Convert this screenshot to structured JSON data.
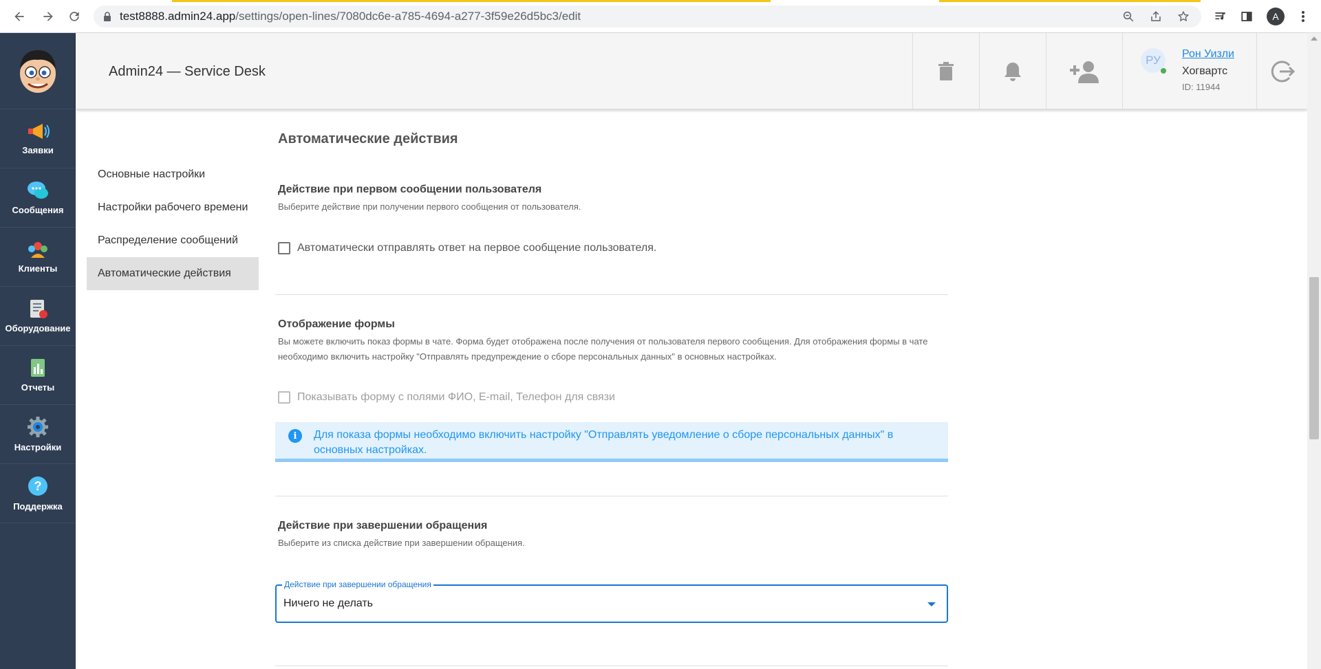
{
  "browser": {
    "url_host": "test8888.admin24.app",
    "url_path": "/settings/open-lines/7080dc6e-a785-4694-a277-3f59e26d5bc3/edit",
    "profile_initial": "A"
  },
  "sidebar": {
    "items": [
      {
        "label": "Заявки",
        "icon": "megaphone-icon"
      },
      {
        "label": "Сообщения",
        "icon": "chat-bubbles-icon"
      },
      {
        "label": "Клиенты",
        "icon": "clients-icon"
      },
      {
        "label": "Оборудование",
        "icon": "equipment-icon"
      },
      {
        "label": "Отчеты",
        "icon": "reports-icon"
      },
      {
        "label": "Настройки",
        "icon": "gear-icon"
      },
      {
        "label": "Поддержка",
        "icon": "help-icon"
      }
    ]
  },
  "header": {
    "title": "Admin24 — Service Desk",
    "user": {
      "initials": "РУ",
      "name": "Рон Уизли",
      "org": "Хогвартс",
      "id": "ID: 11944"
    }
  },
  "subnav": {
    "items": [
      {
        "label": "Основные настройки"
      },
      {
        "label": "Настройки рабочего времени"
      },
      {
        "label": "Распределение сообщений"
      },
      {
        "label": "Автоматические действия"
      }
    ]
  },
  "main": {
    "title": "Автоматические действия",
    "first_message": {
      "title": "Действие при первом сообщении пользователя",
      "description": "Выберите действие при получении первого сообщения от пользователя.",
      "checkbox_label": "Автоматически отправлять ответ на первое сообщение пользователя."
    },
    "form_display": {
      "title": "Отображение формы",
      "description": "Вы можете включить показ формы в чате. Форма будет отображена после получения от пользователя первого сообщения. Для отображения формы в чате необходимо включить настройку \"Отправлять предупреждение о сборе персональных данных\" в основных настройках.",
      "checkbox_label": "Показывать форму с полями ФИО, E-mail, Телефон для связи",
      "info_text": "Для показа формы необходимо включить настройку \"Отправлять уведомление о сборе персональных данных\" в основных настройках."
    },
    "completion": {
      "title": "Действие при завершении обращения",
      "description": "Выберите из списка действие при завершении обращения.",
      "select_label": "Действие при завершении обращения",
      "select_value": "Ничего не делать"
    }
  },
  "colors": {
    "sidebar_bg": "#2f3e53",
    "accent": "#1976d2",
    "info_bg": "#e3f2fd",
    "info_text": "#2196f3"
  }
}
